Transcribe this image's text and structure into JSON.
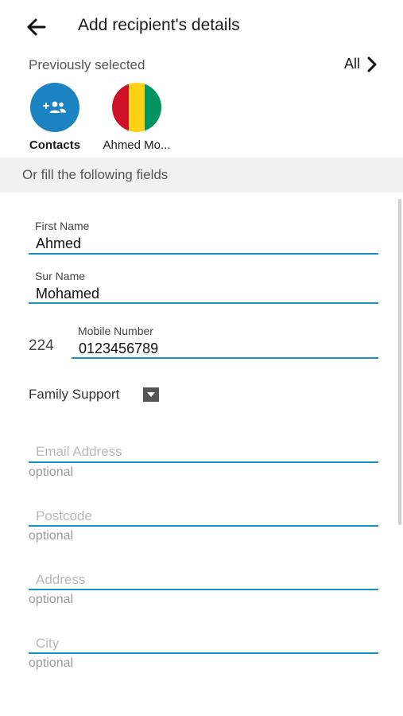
{
  "header": {
    "title": "Add recipient's details",
    "back_icon": "arrow-left-icon"
  },
  "previously_selected": {
    "label": "Previously selected",
    "all_label": "All",
    "items": [
      {
        "name": "Contacts",
        "icon": "add-contacts-icon",
        "color": "#1b83c2"
      },
      {
        "name": "Ahmed Mo...",
        "icon": "guinea-flag",
        "flag_colors": [
          "#ce1126",
          "#fcd116",
          "#009460"
        ]
      }
    ]
  },
  "section": {
    "label": "Or fill the following fields"
  },
  "form": {
    "first_name": {
      "label": "First Name",
      "value": "Ahmed"
    },
    "sur_name": {
      "label": "Sur Name",
      "value": "Mohamed"
    },
    "mobile": {
      "country_code": "224",
      "label": "Mobile Number",
      "value": "0123456789"
    },
    "family_support": {
      "label": "Family Support"
    },
    "email": {
      "placeholder": "Email Address",
      "helper": "optional"
    },
    "postcode": {
      "placeholder": "Postcode",
      "helper": "optional"
    },
    "address": {
      "placeholder": "Address",
      "helper": "optional"
    },
    "city": {
      "placeholder": "City",
      "helper": "optional"
    }
  },
  "colors": {
    "accent": "#1b8fc6"
  }
}
